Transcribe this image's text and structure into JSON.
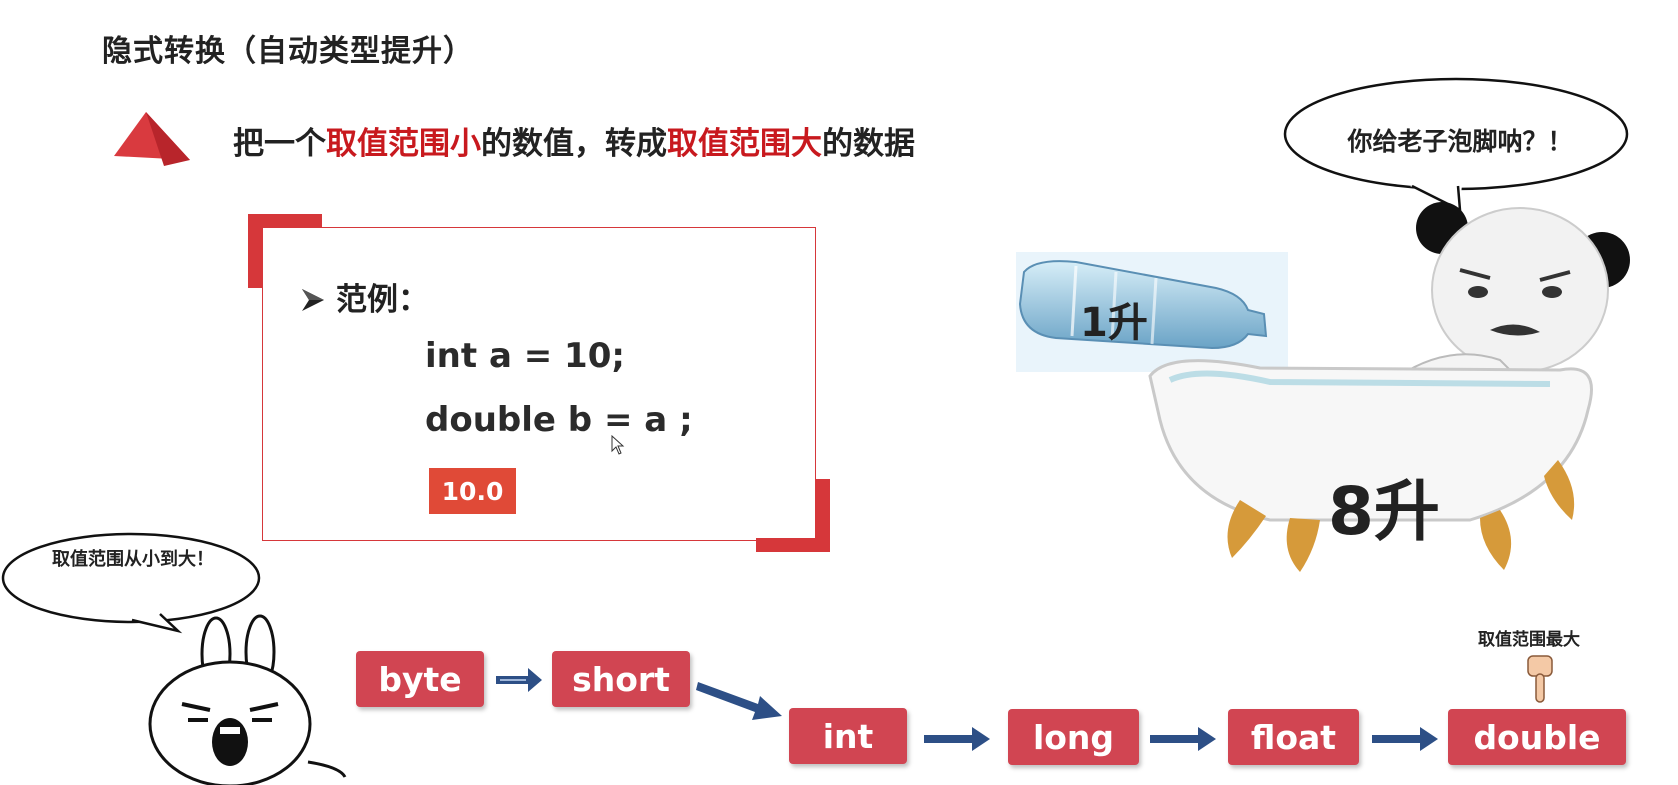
{
  "title": "隐式转换（自动类型提升）",
  "headline": {
    "part1": "把一个",
    "hl1": "取值范围小",
    "part2": "的数值，转成",
    "hl2": "取值范围大",
    "part3": "的数据"
  },
  "example": {
    "label": "范例：",
    "line1": "int a = 10;",
    "line2": "double b = a ;",
    "result": "10.0"
  },
  "bubble_left": "取值范围从小到大！",
  "bubble_right": "你给老子泡脚呐？！",
  "illustration": {
    "bottle_label": "1升",
    "bath_label": "8升"
  },
  "types": [
    "byte",
    "short",
    "int",
    "long",
    "float",
    "double"
  ],
  "max_label": "取值范围最大",
  "colors": {
    "accent_red": "#c8191e",
    "frame_red": "#d6373a",
    "type_box": "#d14552",
    "arrow_blue": "#2d4f86"
  }
}
